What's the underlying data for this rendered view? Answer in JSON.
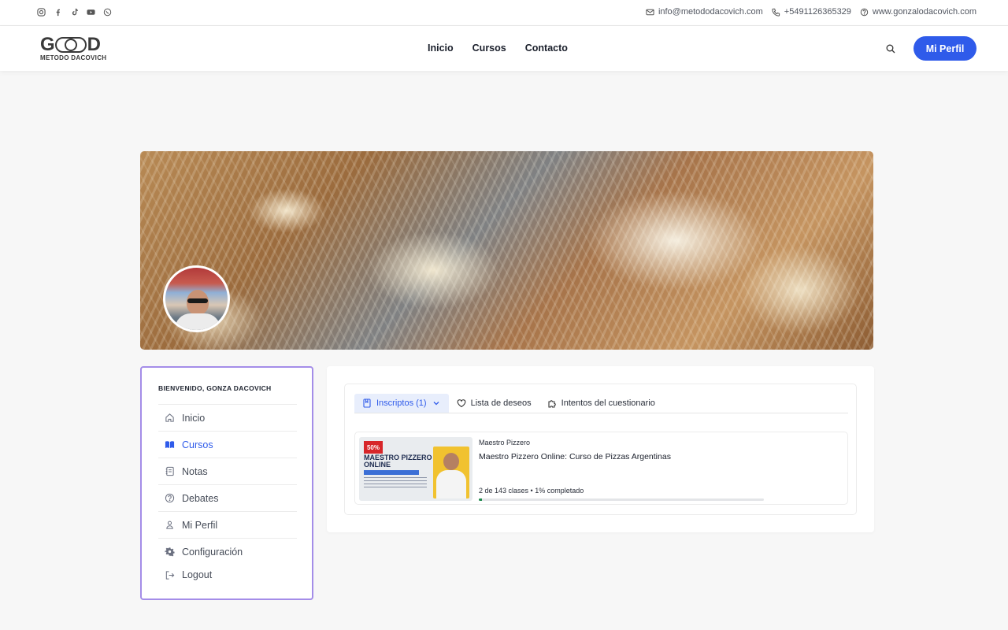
{
  "topbar": {
    "socials": [
      "instagram-icon",
      "facebook-icon",
      "tiktok-icon",
      "youtube-icon",
      "whatsapp-icon"
    ],
    "email": "info@metododacovich.com",
    "phone": "+5491126365329",
    "website": "www.gonzalodacovich.com"
  },
  "header": {
    "logo_mark": "GOOD",
    "logo_sub": "METODO DACOVICH",
    "nav": [
      "Inicio",
      "Cursos",
      "Contacto"
    ],
    "profile_button": "Mi Perfil"
  },
  "sidebar": {
    "welcome": "BIENVENIDO, GONZA DACOVICH",
    "items": [
      {
        "label": "Inicio",
        "icon": "home-icon"
      },
      {
        "label": "Cursos",
        "icon": "book-open-icon"
      },
      {
        "label": "Notas",
        "icon": "notes-icon"
      },
      {
        "label": "Debates",
        "icon": "question-icon"
      },
      {
        "label": "Mi Perfil",
        "icon": "user-icon"
      },
      {
        "label": "Configuración",
        "icon": "gear-icon"
      },
      {
        "label": "Logout",
        "icon": "logout-icon"
      }
    ],
    "active": "Cursos"
  },
  "tabs": [
    {
      "label": "Inscriptos (1)",
      "icon": "bookmark-icon"
    },
    {
      "label": "Lista de deseos",
      "icon": "heart-icon"
    },
    {
      "label": "Intentos del cuestionario",
      "icon": "puzzle-icon"
    }
  ],
  "course": {
    "thumb_badge": "50%",
    "thumb_title": "MAESTRO PIZZERO ONLINE",
    "category": "Maestro Pizzero",
    "title": "Maestro Pizzero Online: Curso de Pizzas Argentinas",
    "meta": "2 de 143 clases • 1% completado",
    "progress_percent": 1
  },
  "colors": {
    "accent": "#2f5bea",
    "sidebar_border": "#a48de8",
    "progress": "#1f8a4c"
  }
}
